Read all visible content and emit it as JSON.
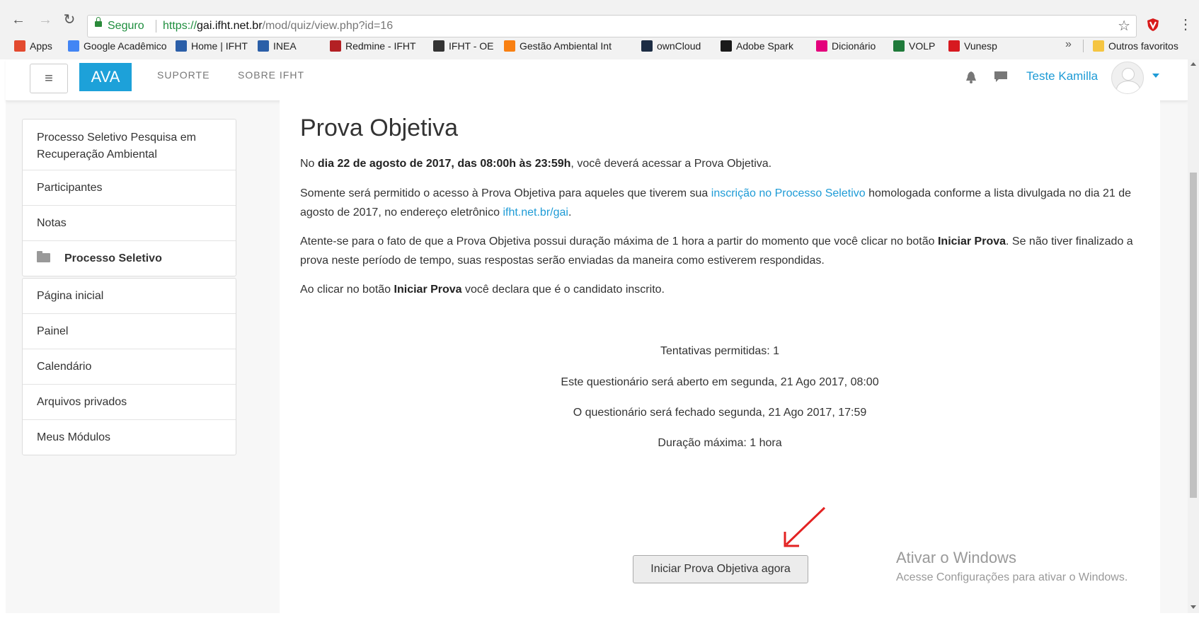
{
  "browser": {
    "secure_label": "Seguro",
    "url_scheme": "https://",
    "url_host": "gai.ifht.net.br",
    "url_path": "/mod/quiz/view.php?id=16",
    "bookmarks": [
      {
        "label": "Apps",
        "icon": "apps-grid-icon",
        "color": "#e34a2f"
      },
      {
        "label": "Google Acadêmico",
        "icon": "google-scholar-icon",
        "color": "#4285f4"
      },
      {
        "label": "Home | IFHT",
        "icon": "ifht-icon",
        "color": "#2b5fa8"
      },
      {
        "label": "INEA",
        "icon": "ifht-icon",
        "color": "#2b5fa8"
      },
      {
        "label": "Redmine - IFHT",
        "icon": "redmine-icon",
        "color": "#b32024"
      },
      {
        "label": "IFHT - OE",
        "icon": "moodle-icon",
        "color": "#333333"
      },
      {
        "label": "Gestão Ambiental Int",
        "icon": "moodle-orange-icon",
        "color": "#f98012"
      },
      {
        "label": "ownCloud",
        "icon": "owncloud-icon",
        "color": "#1d2d44"
      },
      {
        "label": "Adobe Spark",
        "icon": "adobe-spark-icon",
        "color": "#1a1a1a"
      },
      {
        "label": "Dicionário",
        "icon": "priberam-icon",
        "color": "#e4007c"
      },
      {
        "label": "VOLP",
        "icon": "volp-icon",
        "color": "#1f7a3a"
      },
      {
        "label": "Vunesp",
        "icon": "vunesp-icon",
        "color": "#d71920"
      }
    ],
    "more_label": "»",
    "other_bookmarks": "Outros favoritos"
  },
  "topbar": {
    "brand": "AVA",
    "nav": [
      "SUPORTE",
      "SOBRE IFHT"
    ],
    "username": "Teste Kamilla"
  },
  "sidebar": {
    "course_block": [
      {
        "label": "Processo Seletivo Pesquisa em Recuperação Ambiental"
      },
      {
        "label": "Participantes"
      },
      {
        "label": "Notas"
      },
      {
        "label": "Processo Seletivo"
      }
    ],
    "nav_block": [
      {
        "label": "Página inicial"
      },
      {
        "label": "Painel"
      },
      {
        "label": "Calendário"
      },
      {
        "label": "Arquivos privados"
      },
      {
        "label": "Meus Módulos"
      }
    ]
  },
  "main": {
    "title": "Prova Objetiva",
    "p1_pre": "No ",
    "p1_bold": "dia 22 de agosto de 2017, das 08:00h às 23:59h",
    "p1_post": ", você deverá acessar a Prova Objetiva.",
    "p2_pre": "Somente será permitido o acesso à Prova Objetiva para aqueles que tiverem sua ",
    "p2_link": "inscrição no Processo Seletivo",
    "p2_mid": " homologada conforme a lista divulgada no dia 21 de agosto de 2017, no endereço eletrônico ",
    "p2_link2": "ifht.net.br/gai",
    "p2_post": ".",
    "p3_pre": "Atente-se para o fato de que a Prova Objetiva possui duração máxima de 1 hora a partir do momento que você clicar no botão ",
    "p3_bold": "Iniciar Prova",
    "p3_post": ". Se não tiver finalizado a prova neste período de tempo, suas respostas serão enviadas da maneira como estiverem respondidas.",
    "p4_pre": "Ao clicar no botão ",
    "p4_bold": "Iniciar Prova",
    "p4_post": " você declara que é o candidato inscrito.",
    "info": [
      "Tentativas permitidas: 1",
      "Este questionário será aberto em segunda, 21 Ago 2017, 08:00",
      "O questionário será fechado segunda, 21 Ago 2017, 17:59",
      "Duração máxima: 1 hora"
    ],
    "start_button": "Iniciar Prova Objetiva agora"
  },
  "watermark": {
    "line1": "Ativar o Windows",
    "line2": "Acesse Configurações para ativar o Windows."
  },
  "colors": {
    "accent": "#1da1d9",
    "link": "#1e9bd6",
    "arrow": "#e32222"
  }
}
